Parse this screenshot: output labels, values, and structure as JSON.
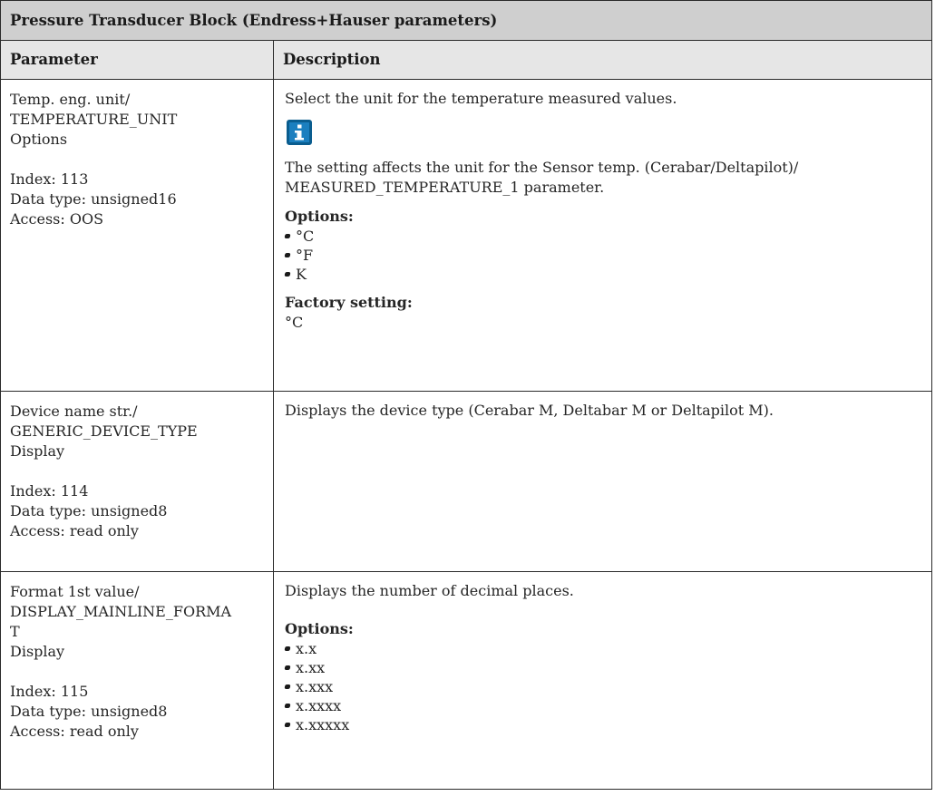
{
  "table": {
    "title": "Pressure Transducer Block (Endress+Hauser parameters)",
    "col_parameter": "Parameter",
    "col_description": "Description",
    "rows": [
      {
        "param": {
          "line1": "Temp. eng. unit/",
          "line2": "TEMPERATURE_UNIT",
          "line3": "Options",
          "index": "Index: 113",
          "dtype": "Data type: unsigned16",
          "access": "Access: OOS"
        },
        "desc": {
          "text": "Select the unit for the temperature measured values.",
          "note_icon": "info-icon",
          "note1": "The setting affects the unit for the Sensor temp. (Cerabar/Deltapilot)/",
          "note2": "MEASURED_TEMPERATURE_1 parameter.",
          "options_label": "Options:",
          "options": [
            "°C",
            "°F",
            "K"
          ],
          "factory_label": "Factory setting:",
          "factory_value": "°C"
        }
      },
      {
        "param": {
          "line1": "Device name str./",
          "line2": "GENERIC_DEVICE_TYPE",
          "line3": "Display",
          "index": "Index: 114",
          "dtype": "Data type: unsigned8",
          "access": "Access: read only"
        },
        "desc": {
          "text": "Displays the device type (Cerabar M, Deltabar M or Deltapilot M)."
        }
      },
      {
        "param": {
          "line1": "Format 1st value/",
          "line2": "DISPLAY_MAINLINE_FORMA",
          "line2b": "T",
          "line3": "Display",
          "index": "Index: 115",
          "dtype": "Data type: unsigned8",
          "access": "Access: read only"
        },
        "desc": {
          "text": "Displays the number of decimal places.",
          "options_label": "Options:",
          "options": [
            "x.x",
            "x.xx",
            "x.xxx",
            "x.xxxx",
            "x.xxxxx"
          ]
        }
      }
    ]
  },
  "colors": {
    "title_bg": "#cfcfcf",
    "header_bg": "#e6e6e6",
    "info_icon": "#1b7fbf"
  }
}
